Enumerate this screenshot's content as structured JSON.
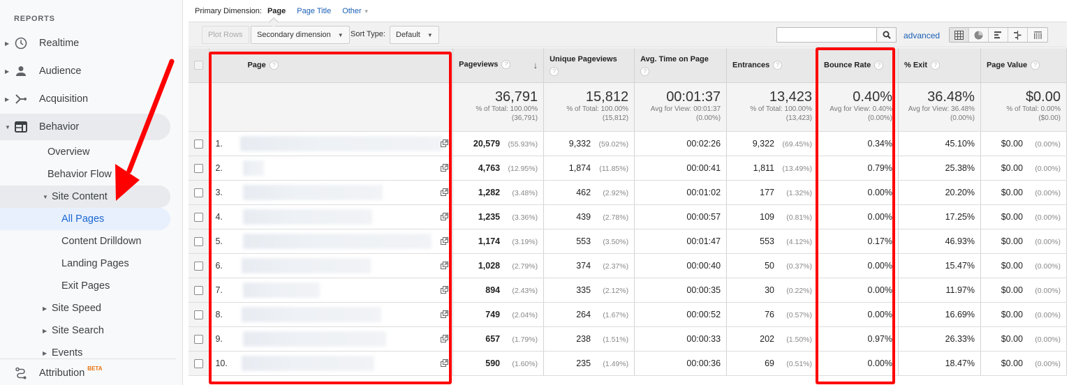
{
  "sidebar": {
    "heading": "REPORTS",
    "items": [
      {
        "label": "Realtime",
        "icon": "clock-icon"
      },
      {
        "label": "Audience",
        "icon": "person-icon"
      },
      {
        "label": "Acquisition",
        "icon": "acquisition-icon"
      },
      {
        "label": "Behavior",
        "icon": "behavior-icon"
      }
    ],
    "behavior_sub": {
      "overview": "Overview",
      "behavior_flow": "Behavior Flow",
      "site_content": "Site Content",
      "site_content_children": [
        "All Pages",
        "Content Drilldown",
        "Landing Pages",
        "Exit Pages"
      ],
      "site_speed": "Site Speed",
      "site_search": "Site Search",
      "events": "Events"
    },
    "attribution": {
      "label": "Attribution",
      "badge": "BETA"
    }
  },
  "primary_dimension": {
    "label": "Primary Dimension:",
    "active": "Page",
    "options": [
      "Page Title",
      "Other"
    ]
  },
  "toolbar": {
    "plot_rows": "Plot Rows",
    "secondary_dimension": "Secondary dimension",
    "sort_type_label": "Sort Type:",
    "sort_type_value": "Default",
    "search_value": "",
    "advanced": "advanced"
  },
  "table": {
    "headers": {
      "page": "Page",
      "pageviews": "Pageviews",
      "unique_pageviews": "Unique Pageviews",
      "avg_time": "Avg. Time on Page",
      "entrances": "Entrances",
      "bounce_rate": "Bounce Rate",
      "exit": "% Exit",
      "page_value": "Page Value"
    },
    "totals": {
      "pageviews": {
        "value": "36,791",
        "sub1": "% of Total: 100.00%",
        "sub2": "(36,791)"
      },
      "unique_pageviews": {
        "value": "15,812",
        "sub1": "% of Total: 100.00%",
        "sub2": "(15,812)"
      },
      "avg_time": {
        "value": "00:01:37",
        "sub1": "Avg for View: 00:01:37",
        "sub2": "(0.00%)"
      },
      "entrances": {
        "value": "13,423",
        "sub1": "% of Total: 100.00%",
        "sub2": "(13,423)"
      },
      "bounce_rate": {
        "value": "0.40%",
        "sub1": "Avg for View: 0.40%",
        "sub2": "(0.00%)"
      },
      "exit": {
        "value": "36.48%",
        "sub1": "Avg for View: 36.48%",
        "sub2": "(0.00%)"
      },
      "page_value": {
        "value": "$0.00",
        "sub1": "% of Total: 0.00%",
        "sub2": "($0.00)"
      }
    },
    "rows": [
      {
        "num": "1.",
        "pv": "20,579",
        "pv_pct": "(55.93%)",
        "upv": "9,332",
        "upv_pct": "(59.02%)",
        "atp": "00:02:26",
        "ent": "9,322",
        "ent_pct": "(69.45%)",
        "br": "0.34%",
        "exit": "45.10%",
        "val": "$0.00",
        "val_pct": "(0.00%)"
      },
      {
        "num": "2.",
        "pv": "4,763",
        "pv_pct": "(12.95%)",
        "upv": "1,874",
        "upv_pct": "(11.85%)",
        "atp": "00:00:41",
        "ent": "1,811",
        "ent_pct": "(13.49%)",
        "br": "0.79%",
        "exit": "25.38%",
        "val": "$0.00",
        "val_pct": "(0.00%)"
      },
      {
        "num": "3.",
        "pv": "1,282",
        "pv_pct": "(3.48%)",
        "upv": "462",
        "upv_pct": "(2.92%)",
        "atp": "00:01:02",
        "ent": "177",
        "ent_pct": "(1.32%)",
        "br": "0.00%",
        "exit": "20.20%",
        "val": "$0.00",
        "val_pct": "(0.00%)"
      },
      {
        "num": "4.",
        "pv": "1,235",
        "pv_pct": "(3.36%)",
        "upv": "439",
        "upv_pct": "(2.78%)",
        "atp": "00:00:57",
        "ent": "109",
        "ent_pct": "(0.81%)",
        "br": "0.00%",
        "exit": "17.25%",
        "val": "$0.00",
        "val_pct": "(0.00%)"
      },
      {
        "num": "5.",
        "pv": "1,174",
        "pv_pct": "(3.19%)",
        "upv": "553",
        "upv_pct": "(3.50%)",
        "atp": "00:01:47",
        "ent": "553",
        "ent_pct": "(4.12%)",
        "br": "0.17%",
        "exit": "46.93%",
        "val": "$0.00",
        "val_pct": "(0.00%)"
      },
      {
        "num": "6.",
        "pv": "1,028",
        "pv_pct": "(2.79%)",
        "upv": "374",
        "upv_pct": "(2.37%)",
        "atp": "00:00:40",
        "ent": "50",
        "ent_pct": "(0.37%)",
        "br": "0.00%",
        "exit": "15.47%",
        "val": "$0.00",
        "val_pct": "(0.00%)"
      },
      {
        "num": "7.",
        "pv": "894",
        "pv_pct": "(2.43%)",
        "upv": "335",
        "upv_pct": "(2.12%)",
        "atp": "00:00:35",
        "ent": "30",
        "ent_pct": "(0.22%)",
        "br": "0.00%",
        "exit": "11.97%",
        "val": "$0.00",
        "val_pct": "(0.00%)"
      },
      {
        "num": "8.",
        "pv": "749",
        "pv_pct": "(2.04%)",
        "upv": "264",
        "upv_pct": "(1.67%)",
        "atp": "00:00:52",
        "ent": "76",
        "ent_pct": "(0.57%)",
        "br": "0.00%",
        "exit": "16.69%",
        "val": "$0.00",
        "val_pct": "(0.00%)"
      },
      {
        "num": "9.",
        "pv": "657",
        "pv_pct": "(1.79%)",
        "upv": "238",
        "upv_pct": "(1.51%)",
        "atp": "00:00:33",
        "ent": "202",
        "ent_pct": "(1.50%)",
        "br": "0.97%",
        "exit": "26.33%",
        "val": "$0.00",
        "val_pct": "(0.00%)"
      },
      {
        "num": "10.",
        "pv": "590",
        "pv_pct": "(1.60%)",
        "upv": "235",
        "upv_pct": "(1.49%)",
        "atp": "00:00:36",
        "ent": "69",
        "ent_pct": "(0.51%)",
        "br": "0.00%",
        "exit": "18.47%",
        "val": "$0.00",
        "val_pct": "(0.00%)"
      }
    ]
  },
  "colors": {
    "annotation_red": "#ff0000",
    "link_blue": "#1a5fb4",
    "active_nav_blue": "#1967d2"
  }
}
